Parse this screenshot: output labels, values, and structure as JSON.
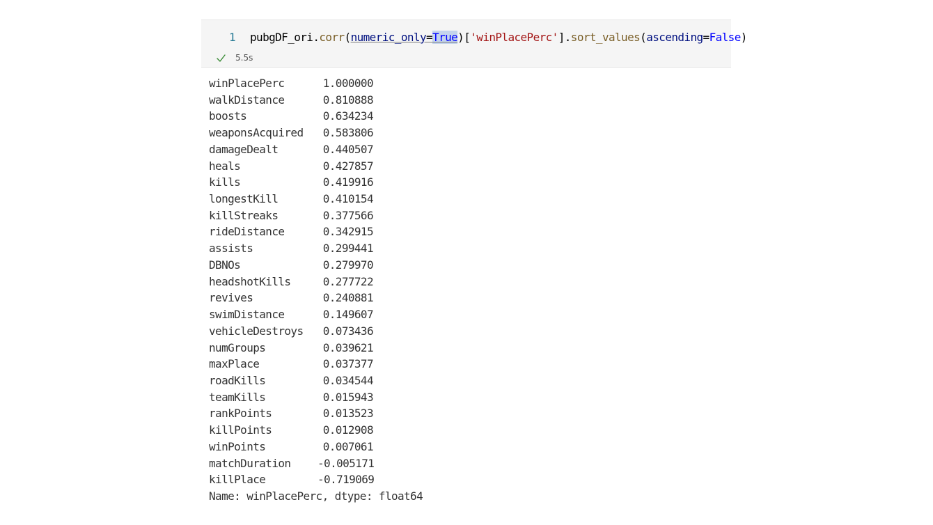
{
  "cell": {
    "line_number": "1",
    "code_tokens": [
      {
        "text": "pubgDF_ori",
        "kind": "plain"
      },
      {
        "text": ".",
        "kind": "plain"
      },
      {
        "text": "corr",
        "kind": "fn"
      },
      {
        "text": "(",
        "kind": "plain"
      },
      {
        "text": "numeric_only",
        "kind": "param-under"
      },
      {
        "text": "=",
        "kind": "plain-under"
      },
      {
        "text": "True",
        "kind": "const-highlight"
      },
      {
        "text": ")[",
        "kind": "plain"
      },
      {
        "text": "'winPlacePerc'",
        "kind": "str"
      },
      {
        "text": "].",
        "kind": "plain"
      },
      {
        "text": "sort_values",
        "kind": "fn"
      },
      {
        "text": "(",
        "kind": "plain"
      },
      {
        "text": "ascending",
        "kind": "param"
      },
      {
        "text": "=",
        "kind": "plain"
      },
      {
        "text": "False",
        "kind": "const"
      },
      {
        "text": ")",
        "kind": "plain"
      }
    ],
    "exec_time": "5.5s",
    "status_icon": "check-icon",
    "colors": {
      "cell_bg": "#f5f5f5",
      "function": "#795e26",
      "parameter": "#001080",
      "constant": "#0000ff",
      "string": "#a31515",
      "highlight": "#c4d4ec",
      "check": "#388a34"
    }
  },
  "output": {
    "rows": [
      {
        "name": "winPlacePerc",
        "value": "1.000000"
      },
      {
        "name": "walkDistance",
        "value": "0.810888"
      },
      {
        "name": "boosts",
        "value": "0.634234"
      },
      {
        "name": "weaponsAcquired",
        "value": "0.583806"
      },
      {
        "name": "damageDealt",
        "value": "0.440507"
      },
      {
        "name": "heals",
        "value": "0.427857"
      },
      {
        "name": "kills",
        "value": "0.419916"
      },
      {
        "name": "longestKill",
        "value": "0.410154"
      },
      {
        "name": "killStreaks",
        "value": "0.377566"
      },
      {
        "name": "rideDistance",
        "value": "0.342915"
      },
      {
        "name": "assists",
        "value": "0.299441"
      },
      {
        "name": "DBNOs",
        "value": "0.279970"
      },
      {
        "name": "headshotKills",
        "value": "0.277722"
      },
      {
        "name": "revives",
        "value": "0.240881"
      },
      {
        "name": "swimDistance",
        "value": "0.149607"
      },
      {
        "name": "vehicleDestroys",
        "value": "0.073436"
      },
      {
        "name": "numGroups",
        "value": "0.039621"
      },
      {
        "name": "maxPlace",
        "value": "0.037377"
      },
      {
        "name": "roadKills",
        "value": "0.034544"
      },
      {
        "name": "teamKills",
        "value": "0.015943"
      },
      {
        "name": "rankPoints",
        "value": "0.013523"
      },
      {
        "name": "killPoints",
        "value": "0.012908"
      },
      {
        "name": "winPoints",
        "value": "0.007061"
      },
      {
        "name": "matchDuration",
        "value": "-0.005171"
      },
      {
        "name": "killPlace",
        "value": "-0.719069"
      }
    ],
    "footer": "Name: winPlacePerc, dtype: float64"
  }
}
